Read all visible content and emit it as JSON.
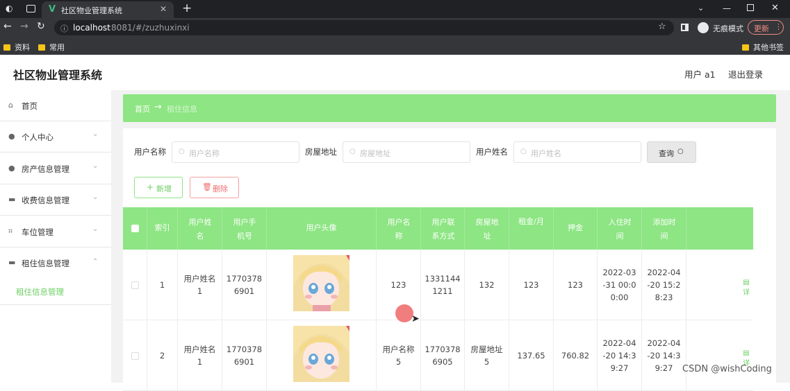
{
  "browser": {
    "tab_title": "社区物业管理系统",
    "url_host": "localhost",
    "url_rest": ":8081/#/zuzhuxinxi",
    "incognito_label": "无痕模式",
    "update_label": "更新",
    "bookmarks": [
      "资料",
      "常用"
    ],
    "other_bookmarks": "其他书签"
  },
  "header": {
    "title": "社区物业管理系统",
    "user_label": "用户 a1",
    "logout": "退出登录"
  },
  "sidebar": {
    "items": [
      {
        "label": "首页",
        "icon": "home-icon"
      },
      {
        "label": "个人中心",
        "icon": "user-icon"
      },
      {
        "label": "房产信息管理",
        "icon": "user-icon"
      },
      {
        "label": "收费信息管理",
        "icon": "monitor-icon"
      },
      {
        "label": "车位管理",
        "icon": "scan-icon"
      },
      {
        "label": "租住信息管理",
        "icon": "monitor-icon"
      }
    ],
    "sub_item": "租住信息管理"
  },
  "breadcrumb": {
    "home": "首页",
    "arrow": "→",
    "current": "租住信息"
  },
  "search": {
    "fields": [
      {
        "label": "用户名称",
        "placeholder": "用户名称"
      },
      {
        "label": "房屋地址",
        "placeholder": "房屋地址"
      },
      {
        "label": "用户姓名",
        "placeholder": "用户姓名"
      }
    ],
    "query_label": "查询"
  },
  "actions": {
    "add_label": "新增",
    "delete_label": "删除"
  },
  "table": {
    "headers": [
      "索引",
      "用户姓名",
      "用户手机号",
      "用户头像",
      "用户名称",
      "用户联系方式",
      "房屋地址",
      "租金/月",
      "押金",
      "入住时间",
      "添加时间"
    ],
    "rows": [
      {
        "index": "1",
        "name": [
          "用户姓名",
          "1"
        ],
        "phone": [
          "1770378",
          "6901"
        ],
        "username": [
          "123"
        ],
        "contact": [
          "1331144",
          "1211"
        ],
        "address": [
          "132"
        ],
        "rent": "123",
        "deposit": "123",
        "checkin": [
          "2022-03",
          "-31 00:0",
          "0:00"
        ],
        "added": [
          "2022-04",
          "-20 15:2",
          "8:23"
        ],
        "op": "详"
      },
      {
        "index": "2",
        "name": [
          "用户姓名",
          "1"
        ],
        "phone": [
          "1770378",
          "6901"
        ],
        "username": [
          "用户名称",
          "5"
        ],
        "contact": [
          "1770378",
          "6905"
        ],
        "address": [
          "房屋地址",
          "5"
        ],
        "rent": "137.65",
        "deposit": "760.82",
        "checkin": [
          "2022-04",
          "-20 14:3",
          "9:27"
        ],
        "added": [
          "2022-04",
          "-20 14:3",
          "9:27"
        ],
        "op": "详"
      }
    ]
  },
  "watermark": "CSDN @wishCoding",
  "colors": {
    "accent": "#8de583",
    "danger": "#f07070",
    "cursor_dot": "#f07070"
  }
}
